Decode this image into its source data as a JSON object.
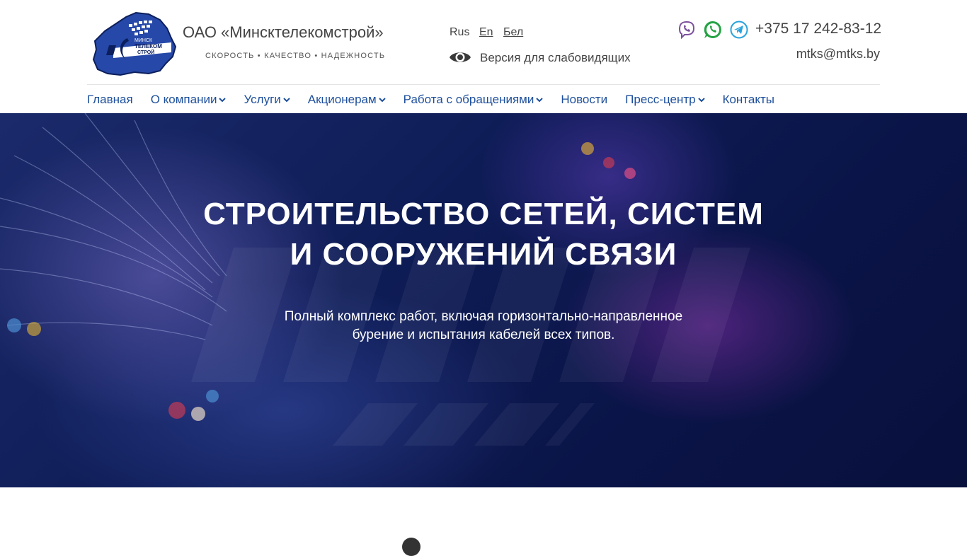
{
  "header": {
    "company_name": "ОАО «Минсктелекомстрой»",
    "tagline": "СКОРОСТЬ • КАЧЕСТВО • НАДЕЖНОСТЬ",
    "logo_text": [
      "МИНСК",
      "ТЕЛЕКОМ",
      "СТРОЙ"
    ],
    "languages": [
      "Rus",
      "En",
      "Бел"
    ],
    "accessibility_label": "Версия для слабовидящих",
    "phone": "+375 17 242-83-12",
    "email": "mtks@mtks.by",
    "social_icons": [
      "viber-icon",
      "whatsapp-icon",
      "telegram-icon"
    ],
    "colors": {
      "brand_blue": "#1d4f9c",
      "viber": "#7b519d",
      "whatsapp": "#25a244",
      "telegram": "#2aa3dd"
    }
  },
  "nav": {
    "items": [
      {
        "label": "Главная",
        "dropdown": false
      },
      {
        "label": "О компании",
        "dropdown": true
      },
      {
        "label": "Услуги",
        "dropdown": true
      },
      {
        "label": "Акционерам",
        "dropdown": true
      },
      {
        "label": "Работа с обращениями",
        "dropdown": true
      },
      {
        "label": "Новости",
        "dropdown": false
      },
      {
        "label": "Пресс-центр",
        "dropdown": true
      },
      {
        "label": "Контакты",
        "dropdown": false
      }
    ]
  },
  "hero": {
    "title_line1": "СТРОИТЕЛЬСТВО СЕТЕЙ, СИСТЕМ",
    "title_line2": "И СООРУЖЕНИЙ СВЯЗИ",
    "subtitle_line1": "Полный комплекс работ, включая горизонтально-направленное",
    "subtitle_line2": "бурение и испытания кабелей всех типов."
  }
}
